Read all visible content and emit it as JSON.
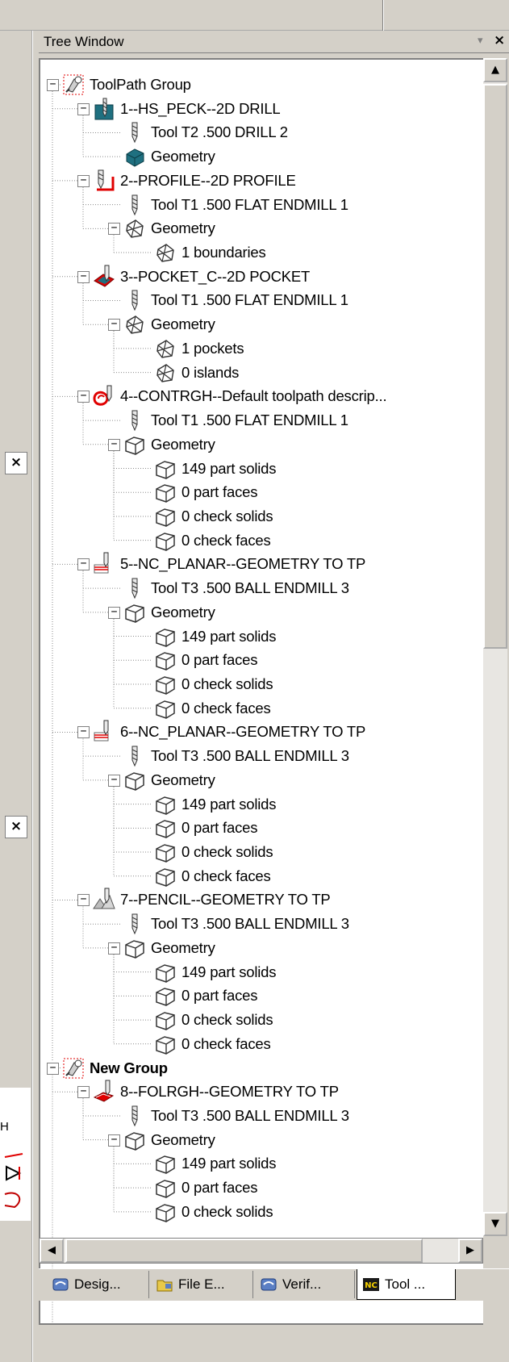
{
  "window": {
    "title": "Tree Window",
    "pin_glyph": "▾",
    "close_glyph": "×"
  },
  "side_panel": {
    "close_glyph": "×",
    "fragment_text": "H"
  },
  "scroll": {
    "up_glyph": "▲",
    "down_glyph": "▼",
    "left_glyph": "◀",
    "right_glyph": "▶"
  },
  "tabs": [
    {
      "label": "Desig...",
      "icon": "design-icon"
    },
    {
      "label": "File E...",
      "icon": "folder-icon"
    },
    {
      "label": "Verif...",
      "icon": "verify-icon"
    },
    {
      "label": "Tool ...",
      "icon": "nc-icon",
      "active": true,
      "badge": "NC"
    }
  ],
  "colors": {
    "highlight_red": "#e00000",
    "teal": "#1f7080",
    "link_blue": "#1f4aa8"
  },
  "tree": [
    {
      "label": "ToolPath Group",
      "level": 0,
      "icon": "toolpath-group-icon",
      "toggle": "−",
      "bold": false
    },
    {
      "label": "1--HS_PECK--2D DRILL",
      "level": 1,
      "icon": "drill-operation-icon",
      "toggle": "−"
    },
    {
      "label": "Tool T2 .500 DRILL 2",
      "level": 2,
      "icon": "tool-icon"
    },
    {
      "label": "Geometry",
      "level": 2,
      "icon": "drill-geometry-icon"
    },
    {
      "label": "2--PROFILE--2D PROFILE",
      "level": 1,
      "icon": "profile-operation-icon",
      "toggle": "−"
    },
    {
      "label": "Tool T1 .500 FLAT ENDMILL 1",
      "level": 2,
      "icon": "tool-icon"
    },
    {
      "label": "Geometry",
      "level": 2,
      "icon": "boundary-geometry-icon",
      "toggle": "−"
    },
    {
      "label": "1 boundaries",
      "level": 3,
      "icon": "boundary-geometry-icon"
    },
    {
      "label": "3--POCKET_C--2D POCKET",
      "level": 1,
      "icon": "pocket-operation-icon",
      "toggle": "−"
    },
    {
      "label": "Tool T1 .500 FLAT ENDMILL 1",
      "level": 2,
      "icon": "tool-icon"
    },
    {
      "label": "Geometry",
      "level": 2,
      "icon": "boundary-geometry-icon",
      "toggle": "−"
    },
    {
      "label": "1 pockets",
      "level": 3,
      "icon": "boundary-geometry-icon"
    },
    {
      "label": "0 islands",
      "level": 3,
      "icon": "boundary-geometry-icon"
    },
    {
      "label": "4--CONTRGH--Default toolpath descrip...",
      "level": 1,
      "icon": "contour-operation-icon",
      "toggle": "−"
    },
    {
      "label": "Tool T1 .500 FLAT ENDMILL 1",
      "level": 2,
      "icon": "tool-icon"
    },
    {
      "label": "Geometry",
      "level": 2,
      "icon": "solid-geometry-icon",
      "toggle": "−"
    },
    {
      "label": "149 part solids",
      "level": 3,
      "icon": "solid-geometry-icon"
    },
    {
      "label": "0 part faces",
      "level": 3,
      "icon": "solid-geometry-icon"
    },
    {
      "label": "0 check solids",
      "level": 3,
      "icon": "solid-geometry-icon"
    },
    {
      "label": "0 check faces",
      "level": 3,
      "icon": "solid-geometry-icon"
    },
    {
      "label": "5--NC_PLANAR--GEOMETRY TO TP",
      "level": 1,
      "icon": "planar-operation-icon",
      "toggle": "−"
    },
    {
      "label": "Tool T3 .500 BALL ENDMILL 3",
      "level": 2,
      "icon": "tool-icon"
    },
    {
      "label": "Geometry",
      "level": 2,
      "icon": "solid-geometry-icon",
      "toggle": "−"
    },
    {
      "label": "149 part solids",
      "level": 3,
      "icon": "solid-geometry-icon"
    },
    {
      "label": "0 part faces",
      "level": 3,
      "icon": "solid-geometry-icon"
    },
    {
      "label": "0 check solids",
      "level": 3,
      "icon": "solid-geometry-icon"
    },
    {
      "label": "0 check faces",
      "level": 3,
      "icon": "solid-geometry-icon"
    },
    {
      "label": "6--NC_PLANAR--GEOMETRY TO TP",
      "level": 1,
      "icon": "planar-operation-icon",
      "toggle": "−"
    },
    {
      "label": "Tool T3 .500 BALL ENDMILL 3",
      "level": 2,
      "icon": "tool-icon"
    },
    {
      "label": "Geometry",
      "level": 2,
      "icon": "solid-geometry-icon",
      "toggle": "−"
    },
    {
      "label": "149 part solids",
      "level": 3,
      "icon": "solid-geometry-icon"
    },
    {
      "label": "0 part faces",
      "level": 3,
      "icon": "solid-geometry-icon"
    },
    {
      "label": "0 check solids",
      "level": 3,
      "icon": "solid-geometry-icon"
    },
    {
      "label": "0 check faces",
      "level": 3,
      "icon": "solid-geometry-icon"
    },
    {
      "label": "7--PENCIL--GEOMETRY TO TP",
      "level": 1,
      "icon": "pencil-operation-icon",
      "toggle": "−"
    },
    {
      "label": "Tool T3 .500 BALL ENDMILL 3",
      "level": 2,
      "icon": "tool-icon"
    },
    {
      "label": "Geometry",
      "level": 2,
      "icon": "solid-geometry-icon",
      "toggle": "−"
    },
    {
      "label": "149 part solids",
      "level": 3,
      "icon": "solid-geometry-icon"
    },
    {
      "label": "0 part faces",
      "level": 3,
      "icon": "solid-geometry-icon"
    },
    {
      "label": "0 check solids",
      "level": 3,
      "icon": "solid-geometry-icon"
    },
    {
      "label": "0 check faces",
      "level": 3,
      "icon": "solid-geometry-icon"
    },
    {
      "label": "New Group",
      "level": 0,
      "icon": "toolpath-group-icon",
      "toggle": "−",
      "bold": true
    },
    {
      "label": "8--FOLRGH--GEOMETRY TO TP",
      "level": 1,
      "icon": "finish-operation-icon",
      "toggle": "−"
    },
    {
      "label": "Tool T3 .500 BALL ENDMILL 3",
      "level": 2,
      "icon": "tool-icon"
    },
    {
      "label": "Geometry",
      "level": 2,
      "icon": "solid-geometry-icon",
      "toggle": "−"
    },
    {
      "label": "149 part solids",
      "level": 3,
      "icon": "solid-geometry-icon"
    },
    {
      "label": "0 part faces",
      "level": 3,
      "icon": "solid-geometry-icon"
    },
    {
      "label": "0 check solids",
      "level": 3,
      "icon": "solid-geometry-icon"
    }
  ]
}
